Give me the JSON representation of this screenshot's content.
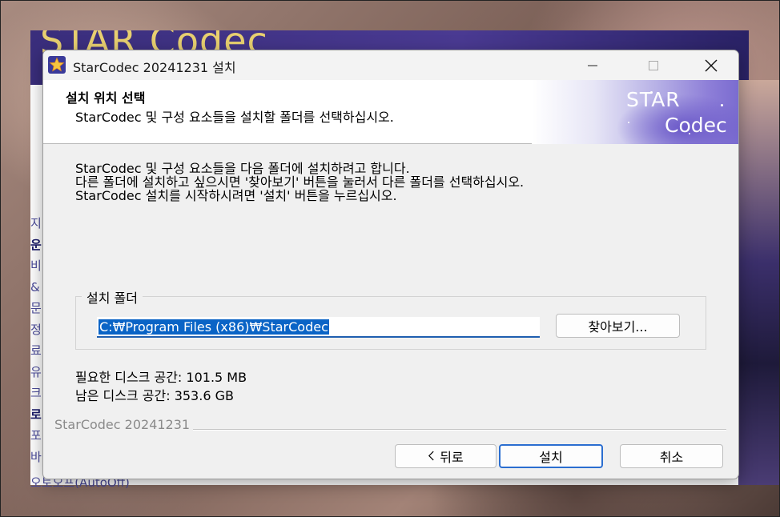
{
  "background": {
    "banner_text": "STAR Codec",
    "side_chars": [
      "지",
      "운",
      "비",
      "&",
      "문",
      "정",
      "료",
      "유",
      "크",
      "로",
      "포",
      "바"
    ],
    "bottom_text": "오토오프(AutoOff)"
  },
  "window": {
    "title": "StarCodec 20241231 설치",
    "icon": "star-icon"
  },
  "header": {
    "title": "설치 위치 선택",
    "subtitle": "StarCodec 및 구성 요소들을 설치할 폴더를 선택하십시오.",
    "logo_line1": "STAR",
    "logo_line2": "Codec"
  },
  "body": {
    "description": [
      "StarCodec 및 구성 요소들을 다음 폴더에 설치하려고 합니다.",
      "다른 폴더에 설치하고 싶으시면 '찾아보기' 버튼을 눌러서 다른 폴더를 선택하십시오.",
      "StarCodec 설치를 시작하시려면 '설치' 버튼을 누르십시오."
    ],
    "folder_group": {
      "label": "설치 폴더",
      "path_value": "C:₩Program Files (x86)₩StarCodec",
      "browse_label": "찾아보기..."
    },
    "space_required": "필요한 디스크 공간: 101.5 MB",
    "space_available": "남은 디스크 공간: 353.6 GB"
  },
  "footer": {
    "branding": "StarCodec 20241231",
    "back_label": "뒤로",
    "install_label": "설치",
    "cancel_label": "취소"
  },
  "colors": {
    "accent": "#0a64c6",
    "focus_border": "#2b6ed0",
    "dialog_bg": "#f0f0f0",
    "logo_purple": "#7a6bd0"
  }
}
